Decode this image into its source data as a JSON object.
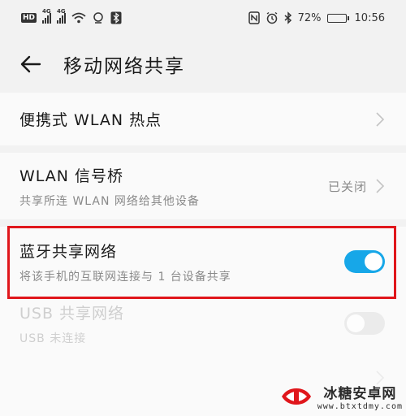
{
  "status_bar": {
    "network_1": "4G",
    "network_2": "4G",
    "battery_percent": 72,
    "battery_label": "72%",
    "time": "10:56"
  },
  "header": {
    "title": "移动网络共享"
  },
  "items": {
    "hotspot": {
      "title": "便携式 WLAN 热点"
    },
    "wlan_bridge": {
      "title": "WLAN 信号桥",
      "subtitle": "共享所连 WLAN 网络给其他设备",
      "status": "已关闭"
    },
    "bluetooth": {
      "title": "蓝牙共享网络",
      "subtitle": "将该手机的互联网连接与 1 台设备共享",
      "enabled": true
    },
    "usb": {
      "title": "USB 共享网络",
      "subtitle": "USB 未连接",
      "enabled": false
    }
  },
  "watermark": {
    "name": "冰糖安卓网",
    "url": "www.btxtdmy.com"
  },
  "colors": {
    "toggle_on": "#17a7e8",
    "highlight": "#e0161b"
  }
}
